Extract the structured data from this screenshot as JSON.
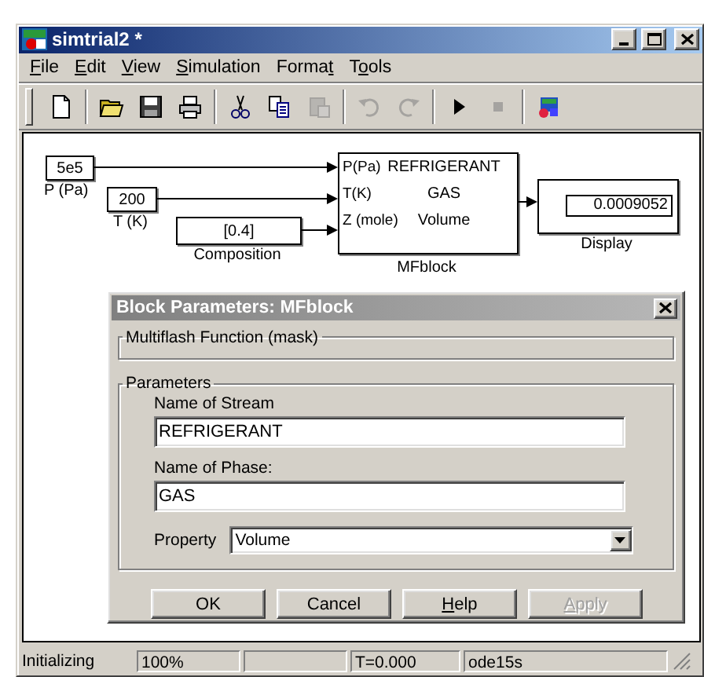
{
  "window": {
    "title": "simtrial2 *",
    "active": true
  },
  "menu": [
    {
      "key": "F",
      "suffix": "ile"
    },
    {
      "key": "E",
      "suffix": "dit"
    },
    {
      "key": "V",
      "suffix": "iew"
    },
    {
      "key": "S",
      "suffix": "imulation"
    },
    {
      "prefix": "Forma",
      "key": "t"
    },
    {
      "prefix": "T",
      "key": "o",
      "suffix": "ols"
    }
  ],
  "toolbar": [
    [
      {
        "kind": "new",
        "disabled": false
      }
    ],
    [
      {
        "kind": "open",
        "disabled": false
      },
      {
        "kind": "save",
        "disabled": false
      },
      {
        "kind": "print",
        "disabled": false
      }
    ],
    [
      {
        "kind": "cut",
        "disabled": false
      },
      {
        "kind": "copy",
        "disabled": false
      },
      {
        "kind": "paste",
        "disabled": true
      }
    ],
    [
      {
        "kind": "undo",
        "disabled": true
      },
      {
        "kind": "redo",
        "disabled": true
      }
    ],
    [
      {
        "kind": "run",
        "disabled": false
      },
      {
        "kind": "stop",
        "disabled": true
      }
    ],
    [
      {
        "kind": "library",
        "disabled": false
      }
    ]
  ],
  "diagram": {
    "blocks": [
      {
        "kind": "constant",
        "value": "5e5",
        "label": "P (Pa)"
      },
      {
        "kind": "constant",
        "value": "200",
        "label": "T (K)"
      },
      {
        "kind": "constant",
        "value": "[0.4]",
        "label": "Composition"
      },
      {
        "kind": "mask",
        "label": "MFblock",
        "ports": [
          "P(Pa)",
          "T(K)",
          "Z (mole)"
        ],
        "lines": [
          "REFRIGERANT",
          "GAS",
          "Volume"
        ]
      },
      {
        "kind": "display",
        "value": "0.0009052",
        "label": "Display"
      }
    ]
  },
  "dialog": {
    "title": "Block Parameters: MFblock",
    "active": false,
    "description_group": {
      "title": "Multiflash Function (mask)"
    },
    "parameters_group": {
      "title": "Parameters",
      "fields": [
        {
          "label": "Name of Stream",
          "value": "REFRIGERANT"
        },
        {
          "label": "Name of Phase:",
          "value": "GAS"
        }
      ],
      "property": {
        "label": "Property",
        "value": "Volume"
      }
    },
    "buttons": [
      {
        "label": "OK",
        "disabled": false
      },
      {
        "label": "Cancel",
        "disabled": false
      },
      {
        "key": "H",
        "suffix": "elp",
        "disabled": false
      },
      {
        "key": "A",
        "suffix": "pply",
        "disabled": true
      }
    ]
  },
  "status_bar": {
    "message": "Initializing",
    "panels": [
      {
        "kind": "text",
        "text": "100%"
      },
      {
        "kind": "empty"
      },
      {
        "kind": "text",
        "text": "T=0.000"
      },
      {
        "kind": "text",
        "text": "ode15s"
      }
    ]
  }
}
